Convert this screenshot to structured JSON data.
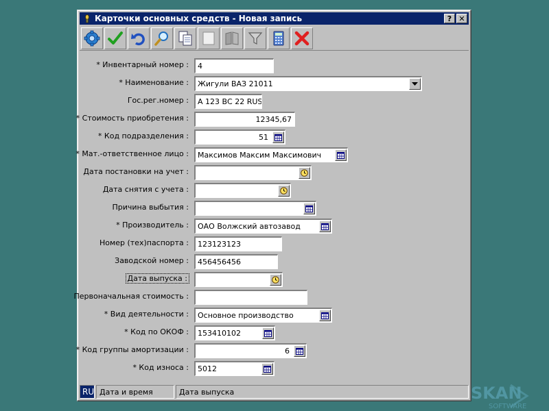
{
  "window": {
    "title": "Карточки основных средств - Новая запись",
    "help_button": "?",
    "close_button": "✕"
  },
  "toolbar": {
    "buttons": [
      {
        "name": "settings",
        "icon": "gear-icon"
      },
      {
        "name": "save",
        "icon": "checkmark-icon"
      },
      {
        "name": "undo",
        "icon": "undo-icon"
      },
      {
        "name": "search",
        "icon": "magnifier-icon"
      },
      {
        "name": "copy",
        "icon": "copy-icon"
      },
      {
        "name": "blank",
        "icon": "blank-page-icon"
      },
      {
        "name": "book",
        "icon": "book-icon"
      },
      {
        "name": "filter",
        "icon": "funnel-icon"
      },
      {
        "name": "calculator",
        "icon": "calculator-icon"
      },
      {
        "name": "delete",
        "icon": "red-x-icon"
      }
    ]
  },
  "fields": {
    "inventory_number": {
      "label": "* Инвентарный номер :",
      "value": "4"
    },
    "name": {
      "label": "* Наименование :",
      "value": "Жигули ВАЗ 21011"
    },
    "gos_reg_number": {
      "label": "Гос.рег.номер :",
      "value": "А 123 ВС 22 RUS"
    },
    "acquisition_cost": {
      "label": "* Стоимость приобретения :",
      "value": "12345,67"
    },
    "department_code": {
      "label": "* Код подразделения :",
      "value": "51"
    },
    "responsible_person": {
      "label": "* Мат.-ответственное лицо :",
      "value": "Максимов Максим Максимович"
    },
    "registration_date": {
      "label": "Дата постановки на учет :",
      "value": ""
    },
    "removal_date": {
      "label": "Дата снятия с учета :",
      "value": ""
    },
    "disposal_reason": {
      "label": "Причина выбытия :",
      "value": ""
    },
    "manufacturer": {
      "label": "* Производитель :",
      "value": "ОАО Волжский автозавод"
    },
    "passport_number": {
      "label": "Номер (тех)паспорта :",
      "value": "123123123"
    },
    "factory_number": {
      "label": "Заводской номер :",
      "value": "456456456"
    },
    "release_date": {
      "label": "Дата выпуска :",
      "value": ""
    },
    "initial_cost": {
      "label": "Первоначальная стоимость :",
      "value": ""
    },
    "activity_type": {
      "label": "* Вид деятельности :",
      "value": "Основное производство"
    },
    "okof_code": {
      "label": "* Код по ОКОФ :",
      "value": "153410102"
    },
    "depreciation_group": {
      "label": "* Код группы амортизации :",
      "value": "6"
    },
    "wear_code": {
      "label": "* Код износа :",
      "value": "5012"
    }
  },
  "statusbar": {
    "lang": "RU",
    "datetime": "Дата и время",
    "hint": "Дата выпуска"
  },
  "watermark": {
    "brand": "SKAN",
    "sub": "SOFTWARE"
  },
  "colors": {
    "desktop": "#3a7878",
    "titlebar": "#0a246a",
    "window": "#c0c0c0"
  }
}
